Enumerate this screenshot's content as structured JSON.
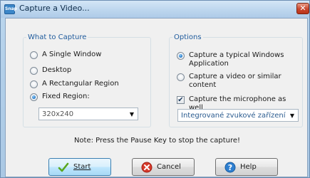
{
  "window": {
    "title": "Capture a Video...",
    "app_icon_text": "Snap",
    "close_glyph": "✕"
  },
  "what_to_capture": {
    "title": "What to Capture",
    "options": [
      {
        "label": "A Single Window",
        "checked": false
      },
      {
        "label": "Desktop",
        "checked": false
      },
      {
        "label": "A Rectangular Region",
        "checked": false
      },
      {
        "label": "Fixed Region:",
        "checked": true
      }
    ],
    "region_size": "320x240"
  },
  "options_group": {
    "title": "Options",
    "capture_type": [
      {
        "label": "Capture a typical Windows Application",
        "checked": true
      },
      {
        "label": "Capture a video or similar content",
        "checked": false
      }
    ],
    "microphone_label": "Capture the microphone as well",
    "microphone_checked": true,
    "audio_device": "Integrované zvukové zařízení In"
  },
  "note": "Note: Press the Pause Key to stop the capture!",
  "buttons": {
    "start": "Start",
    "cancel": "Cancel",
    "help": "Help"
  },
  "colors": {
    "group_title": "#1e5a9c",
    "close_button": "#c9462d"
  },
  "icons": [
    "check-icon",
    "cancel-icon",
    "help-icon",
    "app-icon",
    "dropdown-arrow-icon"
  ]
}
